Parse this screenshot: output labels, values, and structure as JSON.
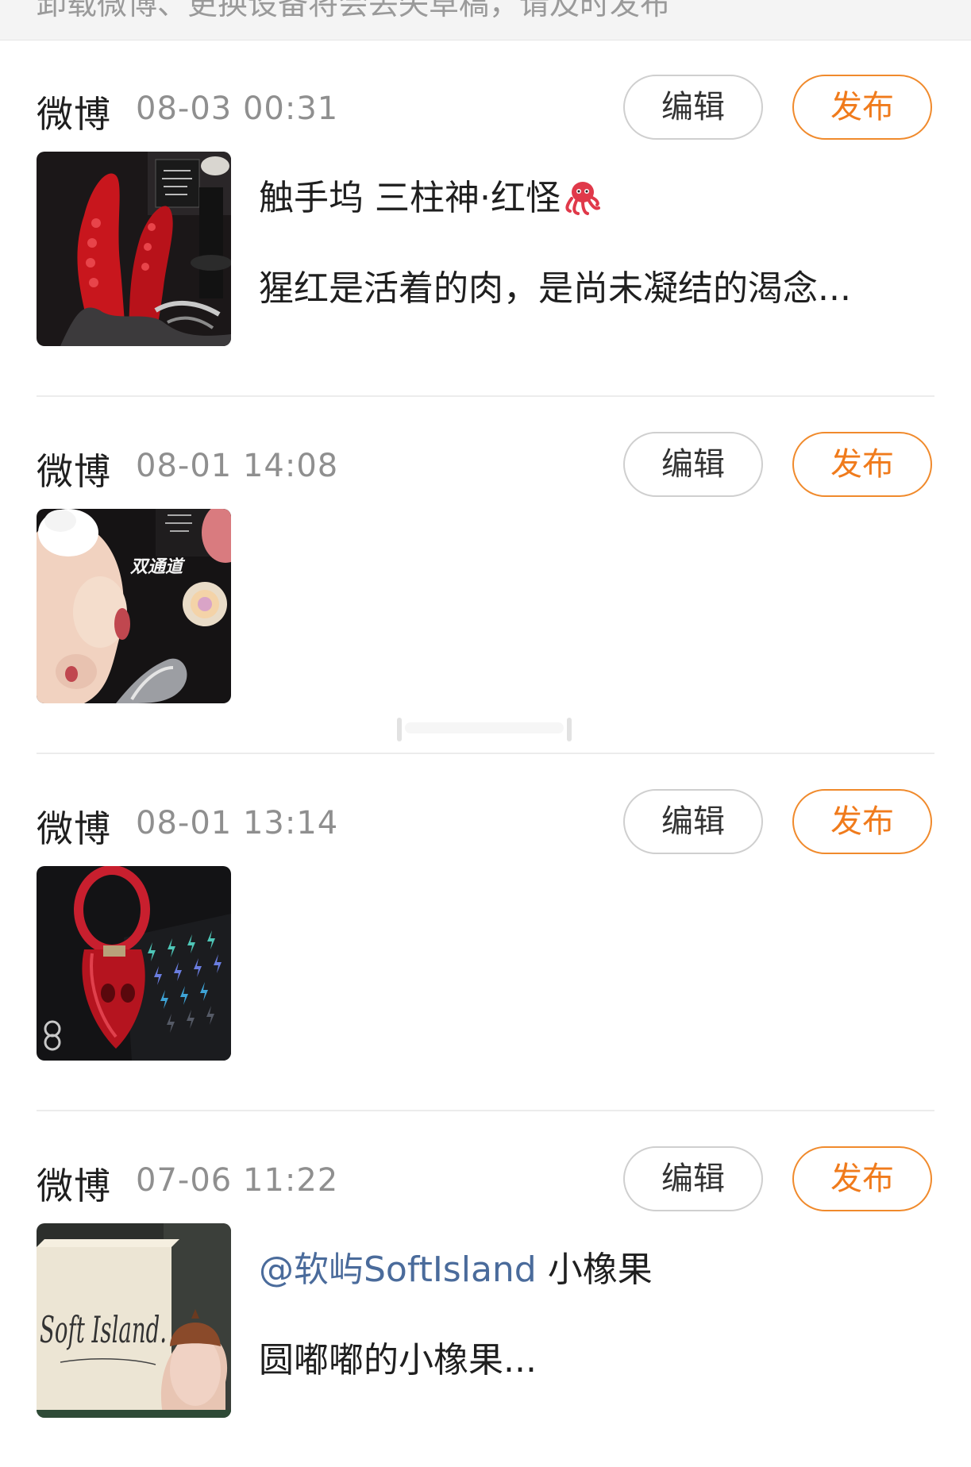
{
  "notice": {
    "text": "卸载微博、更换设备将会丢失草稿，请及时发布"
  },
  "drafts": [
    {
      "source": "微博",
      "time": "08-03 00:31",
      "edit_label": "编辑",
      "publish_label": "发布",
      "thumbnail_icon": "image-thumbnail-icon",
      "title": "触手坞 三柱神·红怪",
      "title_emoji": "octopus-icon",
      "body": "猩红是活着的肉，是尚未凝结的渴念..."
    },
    {
      "source": "微博",
      "time": "08-01 14:08",
      "edit_label": "编辑",
      "publish_label": "发布",
      "thumbnail_icon": "image-thumbnail-icon",
      "thumbnail_text": "双通道"
    },
    {
      "source": "微博",
      "time": "08-01 13:14",
      "edit_label": "编辑",
      "publish_label": "发布",
      "thumbnail_icon": "image-thumbnail-icon"
    },
    {
      "source": "微博",
      "time": "07-06 11:22",
      "edit_label": "编辑",
      "publish_label": "发布",
      "thumbnail_icon": "image-thumbnail-icon",
      "thumbnail_text": "Soft Island.",
      "mention": "@软屿SoftIsland",
      "title_rest": " 小橡果",
      "body": "圆嘟嘟的小橡果..."
    }
  ],
  "colors": {
    "publish_accent": "#f07b1c",
    "mention": "#4a6b9b",
    "time_gray": "#8f8f8f"
  }
}
